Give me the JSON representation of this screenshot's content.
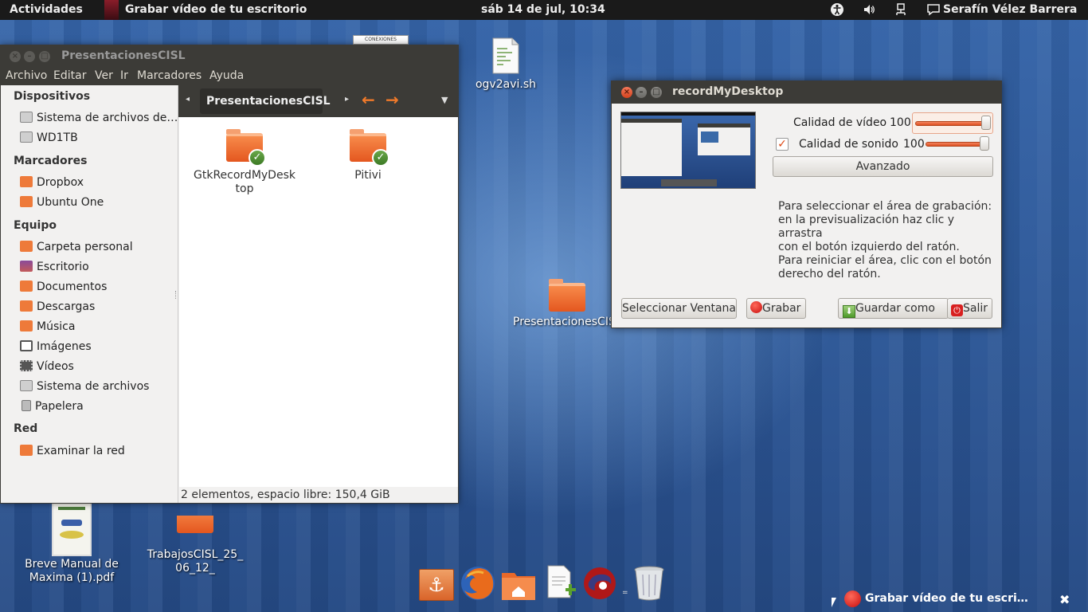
{
  "topbar": {
    "activities": "Actividades",
    "app_title": "Grabar vídeo de tu escritorio",
    "clock": "sáb 14 de jul, 10:34",
    "user": "Serafín Vélez Barrera"
  },
  "desktop": {
    "icons": {
      "ogv2avi": "ogv2avi.sh",
      "presentaciones": "PresentacionesCISL",
      "trabajos": "TrabajosCISL_25_\n06_12_",
      "manual": "Breve Manual de Maxima (1).pdf",
      "conexiones_thumb": "CONEXIONES"
    }
  },
  "nautilus": {
    "title": "PresentacionesCISL",
    "menu": [
      "Archivo",
      "Editar",
      "Ver",
      "Ir",
      "Marcadores",
      "Ayuda"
    ],
    "location": "PresentacionesCISL",
    "sidebar": {
      "devices_header": "Dispositivos",
      "devices": [
        "Sistema de archivos de…",
        "WD1TB"
      ],
      "bookmarks_header": "Marcadores",
      "bookmarks": [
        "Dropbox",
        "Ubuntu One"
      ],
      "computer_header": "Equipo",
      "computer": [
        "Carpeta personal",
        "Escritorio",
        "Documentos",
        "Descargas",
        "Música",
        "Imágenes",
        "Vídeos",
        "Sistema de archivos",
        "Papelera"
      ],
      "network_header": "Red",
      "network": [
        "Examinar la red"
      ]
    },
    "files": [
      "GtkRecordMyDesktop",
      "Pitivi"
    ],
    "status": "2 elementos, espacio libre: 150,4 GiB"
  },
  "rmd": {
    "title": "recordMyDesktop",
    "video_quality_label": "Calidad de vídeo",
    "video_quality_value": "100",
    "sound_quality_label": "Calidad de sonido",
    "sound_quality_value": "100",
    "sound_enabled": true,
    "advanced_button": "Avanzado",
    "help_text_1": "Para seleccionar el área de grabación:\nen la previsualización haz clic y arrastra\ncon el botón izquierdo del ratón.",
    "help_text_2": "Para reiniciar el área, clic con el botón\nderecho del ratón.",
    "select_window_button": "Seleccionar Ventana",
    "record_button": "Grabar",
    "save_as_button": "Guardar como",
    "quit_button": "Salir"
  },
  "bottom": {
    "notification": "Grabar vídeo de tu escri…"
  },
  "colors": {
    "ubuntu_orange": "#dd4814",
    "title_dark": "#3c3b37",
    "window_bg": "#f2f1f0"
  }
}
